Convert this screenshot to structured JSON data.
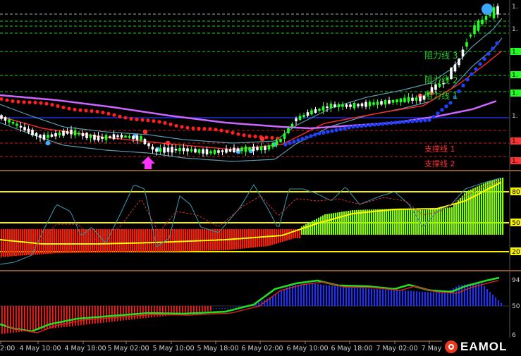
{
  "chart_data": [
    {
      "type": "candlestick",
      "panel": "price",
      "level_labels": [
        "阻力线 3",
        "阻力线 2",
        "阻力线 1",
        "支撑线 1",
        "支撑线 2"
      ],
      "right_axis_ticks": [
        "1.",
        "1.",
        "1.",
        "1.",
        "1.",
        "1.",
        "1.",
        "1.",
        "1.",
        "1.",
        "1."
      ],
      "colors": {
        "bull": "#22ff22",
        "bear": "#ffffff",
        "dots_red": "#ff2020",
        "dots_blue": "#2040ff",
        "ma_purple": "#cc66ff",
        "resistance": "#22cc22",
        "support": "#cc2222",
        "envelope": "#5a9ab0"
      }
    },
    {
      "type": "histogram",
      "panel": "oscillator",
      "levels": [
        80,
        50,
        20
      ],
      "ylim": [
        0,
        100
      ],
      "colors": {
        "up": "#88ff00",
        "down": "#ff1a00",
        "signal": "#ffff00"
      }
    },
    {
      "type": "histogram",
      "panel": "momentum",
      "right_axis_ticks": [
        "94",
        "50",
        "6"
      ],
      "ylim": [
        0,
        100
      ],
      "colors": {
        "up": "#2030ff",
        "down": "#ff1a1a",
        "fast": "#22dd22",
        "slow": "#dd2222"
      }
    }
  ],
  "x_axis": {
    "labels": [
      "2:00",
      "4 May 10:00",
      "4 May 18:00",
      "5 May 02:00",
      "5 May 10:00",
      "5 May 18:00",
      "6 May 02:00",
      "6 May 10:00",
      "6 May 18:00",
      "7 May 02:00",
      "7 May"
    ]
  },
  "brand": {
    "logo_text": "EAMOL"
  }
}
